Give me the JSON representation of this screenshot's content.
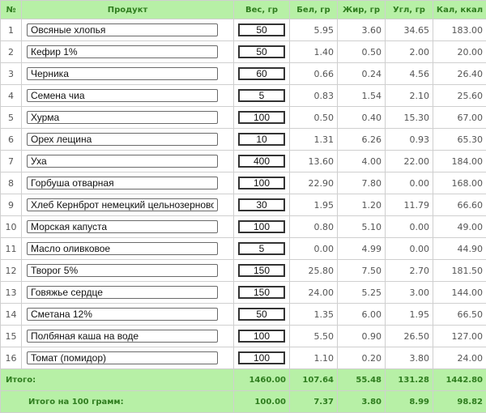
{
  "headers": {
    "num": "№",
    "product": "Продукт",
    "weight": "Вес, гр",
    "protein": "Бел, гр",
    "fat": "Жир, гр",
    "carbs": "Угл, гр",
    "kcal": "Кал, ккал"
  },
  "rows": [
    {
      "num": "1",
      "name": "Овсяные хлопья",
      "weight": "50",
      "protein": "5.95",
      "fat": "3.60",
      "carbs": "34.65",
      "kcal": "183.00"
    },
    {
      "num": "2",
      "name": "Кефир 1%",
      "weight": "50",
      "protein": "1.40",
      "fat": "0.50",
      "carbs": "2.00",
      "kcal": "20.00"
    },
    {
      "num": "3",
      "name": "Черника",
      "weight": "60",
      "protein": "0.66",
      "fat": "0.24",
      "carbs": "4.56",
      "kcal": "26.40"
    },
    {
      "num": "4",
      "name": "Семена чиа",
      "weight": "5",
      "protein": "0.83",
      "fat": "1.54",
      "carbs": "2.10",
      "kcal": "25.60"
    },
    {
      "num": "5",
      "name": "Хурма",
      "weight": "100",
      "protein": "0.50",
      "fat": "0.40",
      "carbs": "15.30",
      "kcal": "67.00"
    },
    {
      "num": "6",
      "name": "Орех лещина",
      "weight": "10",
      "protein": "1.31",
      "fat": "6.26",
      "carbs": "0.93",
      "kcal": "65.30"
    },
    {
      "num": "7",
      "name": "Уха",
      "weight": "400",
      "protein": "13.60",
      "fat": "4.00",
      "carbs": "22.00",
      "kcal": "184.00"
    },
    {
      "num": "8",
      "name": "Горбуша отварная",
      "weight": "100",
      "protein": "22.90",
      "fat": "7.80",
      "carbs": "0.00",
      "kcal": "168.00"
    },
    {
      "num": "9",
      "name": "Хлеб Кернброт немецкий цельнозерновой",
      "weight": "30",
      "protein": "1.95",
      "fat": "1.20",
      "carbs": "11.79",
      "kcal": "66.60"
    },
    {
      "num": "10",
      "name": "Морская капуста",
      "weight": "100",
      "protein": "0.80",
      "fat": "5.10",
      "carbs": "0.00",
      "kcal": "49.00"
    },
    {
      "num": "11",
      "name": "Масло оливковое",
      "weight": "5",
      "protein": "0.00",
      "fat": "4.99",
      "carbs": "0.00",
      "kcal": "44.90"
    },
    {
      "num": "12",
      "name": "Творог 5%",
      "weight": "150",
      "protein": "25.80",
      "fat": "7.50",
      "carbs": "2.70",
      "kcal": "181.50"
    },
    {
      "num": "13",
      "name": "Говяжье сердце",
      "weight": "150",
      "protein": "24.00",
      "fat": "5.25",
      "carbs": "3.00",
      "kcal": "144.00"
    },
    {
      "num": "14",
      "name": "Сметана 12%",
      "weight": "50",
      "protein": "1.35",
      "fat": "6.00",
      "carbs": "1.95",
      "kcal": "66.50"
    },
    {
      "num": "15",
      "name": "Полбяная каша на воде",
      "weight": "100",
      "protein": "5.50",
      "fat": "0.90",
      "carbs": "26.50",
      "kcal": "127.00"
    },
    {
      "num": "16",
      "name": "Томат (помидор)",
      "weight": "100",
      "protein": "1.10",
      "fat": "0.20",
      "carbs": "3.80",
      "kcal": "24.00"
    }
  ],
  "totals": {
    "label": "Итого:",
    "weight": "1460.00",
    "protein": "107.64",
    "fat": "55.48",
    "carbs": "131.28",
    "kcal": "1442.80"
  },
  "per100": {
    "label": "Итого на 100 грамм:",
    "weight": "100.00",
    "protein": "7.37",
    "fat": "3.80",
    "carbs": "8.99",
    "kcal": "98.82"
  },
  "colors": {
    "header_bg": "#b7f0a6",
    "header_text": "#2f7d1f"
  }
}
